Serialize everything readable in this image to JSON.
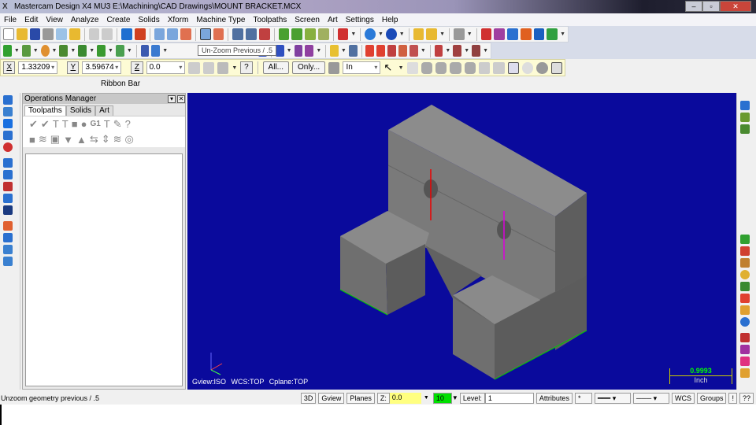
{
  "window": {
    "title": "Mastercam Design X4 MU3  E:\\Machining\\CAD Drawings\\MOUNT BRACKET.MCX",
    "min": "–",
    "max": "▫",
    "close": "✕"
  },
  "menu": [
    "File",
    "Edit",
    "View",
    "Analyze",
    "Create",
    "Solids",
    "Xform",
    "Machine Type",
    "Toolpaths",
    "Screen",
    "Art",
    "Settings",
    "Help"
  ],
  "tooltip": "Un-Zoom Previous / .5",
  "ribbon": {
    "x_label": "X",
    "x_value": "1.33209",
    "y_label": "Y",
    "y_value": "3.59674",
    "z_label": "Z",
    "z_value": "0.0",
    "all_button": "All...",
    "only_button": "Only...",
    "mode": "In",
    "help": "?"
  },
  "ribbon_label": "Ribbon Bar",
  "ops_manager": {
    "title": "Operations Manager",
    "tabs": [
      "Toolpaths",
      "Solids",
      "Art"
    ],
    "g1": "G1"
  },
  "viewport": {
    "gview": "Gview:ISO",
    "wcs": "WCS:TOP",
    "cplane": "Cplane:TOP",
    "scale_value": "0.9993",
    "scale_unit": "Inch",
    "bg": "#0a0a9c"
  },
  "status": {
    "message": "Unzoom geometry previous / .5",
    "btn_3d": "3D",
    "gview": "Gview",
    "planes": "Planes",
    "z_label": "Z:",
    "z_value": "0.0",
    "color_value": "10",
    "level_label": "Level:",
    "level_value": "1",
    "attributes": "Attributes",
    "point_style": "*",
    "wcs": "WCS",
    "groups": "Groups",
    "bang": "!",
    "help": "??"
  }
}
